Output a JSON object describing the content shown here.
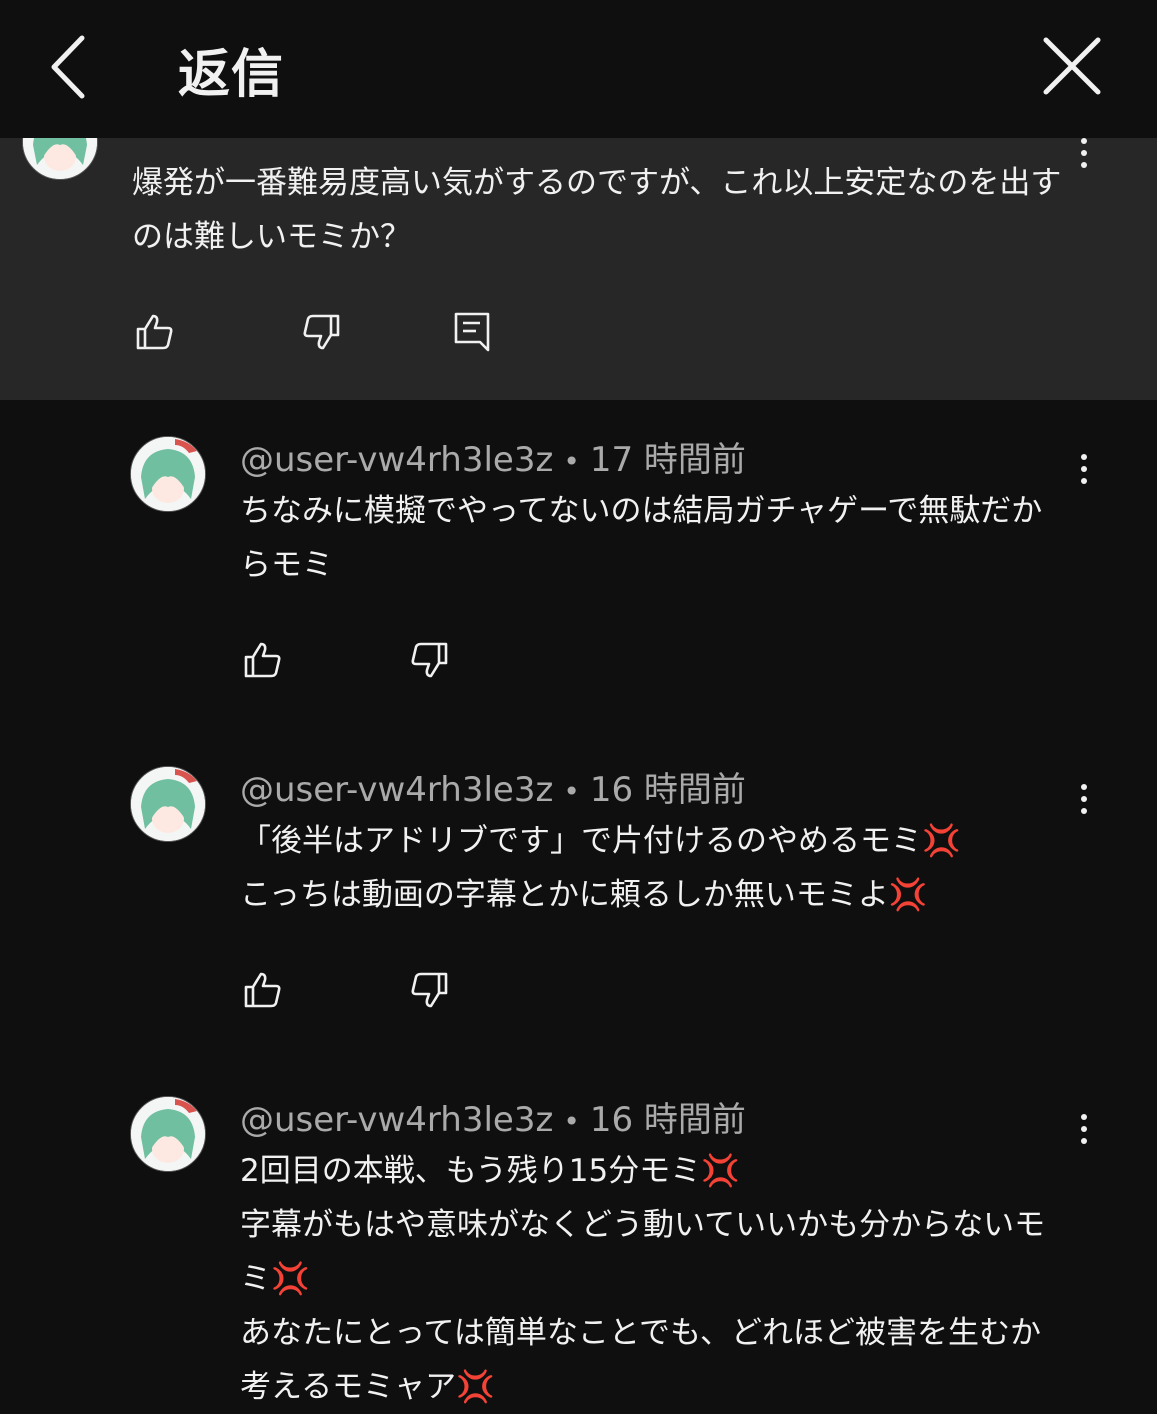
{
  "header": {
    "title": "返信"
  },
  "parent": {
    "text": "爆発が一番難易度高い気がするのですが、これ以上安定なのを出すのは難しいモミか？"
  },
  "replies": [
    {
      "user": "@user-vw4rh3le3z",
      "time": "17 時間前",
      "lines": [
        "ちなみに模擬でやってないのは結局ガチャゲーで無駄だからモミ"
      ]
    },
    {
      "user": "@user-vw4rh3le3z",
      "time": "16 時間前",
      "lines": [
        "「後半はアドリブです」で片付けるのやめるモミ💢",
        "こっちは動画の字幕とかに頼るしか無いモミよ💢"
      ]
    },
    {
      "user": "@user-vw4rh3le3z",
      "time": "16 時間前",
      "lines": [
        "2回目の本戦、もう残り15分モミ💢",
        "字幕がもはや意味がなくどう動いていいかも分からないモミ💢",
        "あなたにとっては簡単なことでも、どれほど被害を生むか考えるモミャア💢"
      ]
    }
  ],
  "colors": {
    "background": "#0f0f0f",
    "parent_bg": "#272727",
    "meta": "#aaaaaa",
    "anger": "#e0334a"
  }
}
